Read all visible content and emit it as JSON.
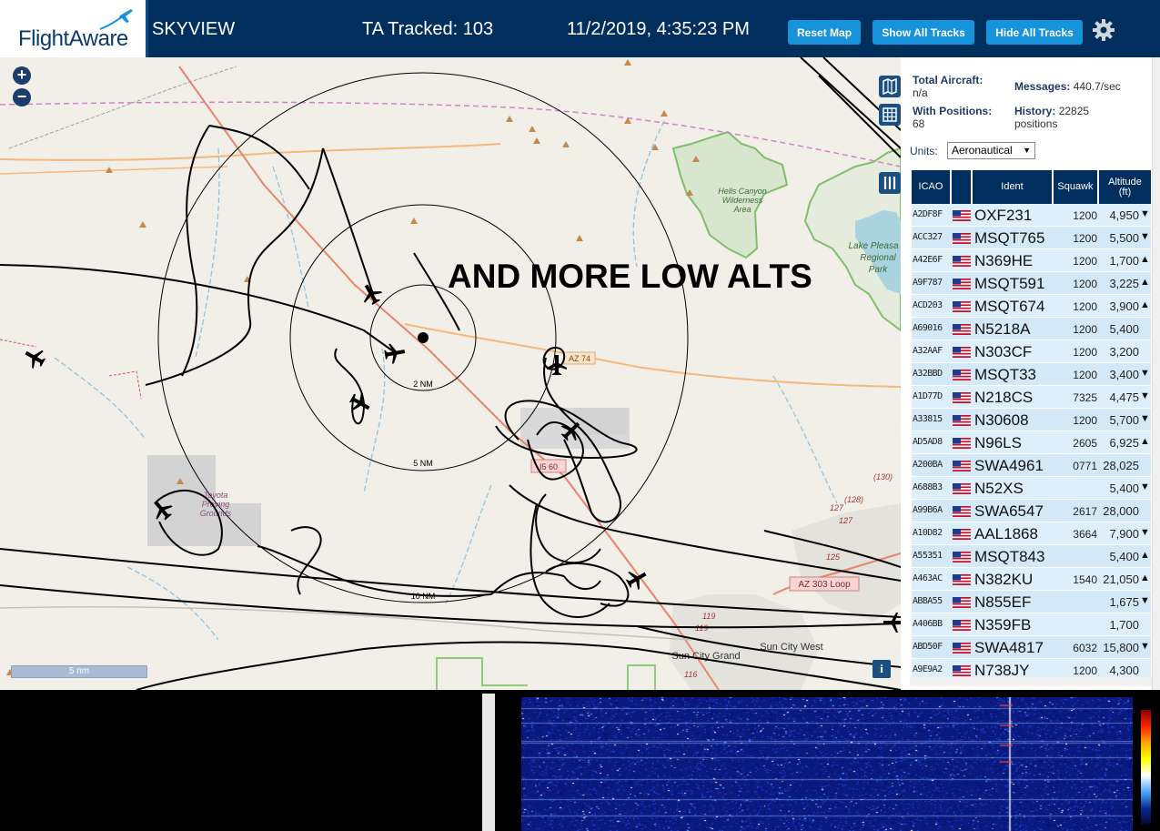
{
  "header": {
    "logo_text": "FlightAware",
    "title": "SKYVIEW",
    "tracked": "TA Tracked: 103",
    "datetime": "11/2/2019, 4:35:23 PM",
    "buttons": {
      "reset": "Reset Map",
      "show_all": "Show All Tracks",
      "hide_all": "Hide All Tracks"
    },
    "settings_icon": "gear-icon",
    "brand_color": "#002f5d",
    "button_color": "#1793db"
  },
  "map": {
    "zoom_in": "+",
    "zoom_out": "−",
    "overlay_text": "AND MORE LOW ALTS",
    "scale_label": "5 nm",
    "info_label": "i",
    "range_labels": [
      "2 NM",
      "5 NM",
      "10 NM"
    ],
    "place_labels": {
      "hells_canyon": [
        "Hells Canyon",
        "Wilderness",
        "Area"
      ],
      "lake_pleasant": [
        "Lake Pleasa",
        "Regional",
        "Park"
      ],
      "toyota": [
        "Toyota",
        "Proving",
        "Grounds"
      ],
      "sun_city_grand": "Sun City Grand",
      "sun_city_west": "Sun City West"
    },
    "road_labels": [
      "AZ 74",
      "I5 60",
      "AZ 303 Loop",
      "(130)",
      "(128)",
      "127",
      "125",
      "119",
      "119",
      "116",
      "127"
    ]
  },
  "panel": {
    "total_aircraft_label": "Total Aircraft:",
    "total_aircraft_value": "n/a",
    "with_positions_label": "With Positions:",
    "with_positions_value": "68",
    "messages_label": "Messages:",
    "messages_value": "440.7/sec",
    "history_label": "History:",
    "history_value": "22825",
    "history_unit": "positions",
    "units_label": "Units:",
    "units_value": "Aeronautical",
    "columns": {
      "icao": "ICAO",
      "ident": "Ident",
      "squawk": "Squawk",
      "altitude_top": "Altitude",
      "altitude_unit": "(ft)"
    },
    "rows": [
      {
        "icao": "A2DF8F",
        "ident": "OXF231",
        "squawk": "1200",
        "alt": "4,950",
        "trend": "▼"
      },
      {
        "icao": "ACC327",
        "ident": "MSQT765",
        "squawk": "1200",
        "alt": "5,500",
        "trend": "▼"
      },
      {
        "icao": "A42E6F",
        "ident": "N369HE",
        "squawk": "1200",
        "alt": "1,700",
        "trend": "▲"
      },
      {
        "icao": "A9F787",
        "ident": "MSQT591",
        "squawk": "1200",
        "alt": "3,225",
        "trend": "▲"
      },
      {
        "icao": "ACD203",
        "ident": "MSQT674",
        "squawk": "1200",
        "alt": "3,900",
        "trend": "▲"
      },
      {
        "icao": "A69016",
        "ident": "N5218A",
        "squawk": "1200",
        "alt": "5,400",
        "trend": ""
      },
      {
        "icao": "A32AAF",
        "ident": "N303CF",
        "squawk": "1200",
        "alt": "3,200",
        "trend": ""
      },
      {
        "icao": "A32BBD",
        "ident": "MSQT33",
        "squawk": "1200",
        "alt": "3,400",
        "trend": "▼"
      },
      {
        "icao": "A1D77D",
        "ident": "N218CS",
        "squawk": "7325",
        "alt": "4,475",
        "trend": "▼"
      },
      {
        "icao": "A33815",
        "ident": "N30608",
        "squawk": "1200",
        "alt": "5,700",
        "trend": "▼"
      },
      {
        "icao": "AD5AD8",
        "ident": "N96LS",
        "squawk": "2605",
        "alt": "6,925",
        "trend": "▲"
      },
      {
        "icao": "A200BA",
        "ident": "SWA4961",
        "squawk": "0771",
        "alt": "28,025",
        "trend": ""
      },
      {
        "icao": "A688B3",
        "ident": "N52XS",
        "squawk": "",
        "alt": "5,400",
        "trend": "▼"
      },
      {
        "icao": "A99B6A",
        "ident": "SWA6547",
        "squawk": "2617",
        "alt": "28,000",
        "trend": ""
      },
      {
        "icao": "A10D82",
        "ident": "AAL1868",
        "squawk": "3664",
        "alt": "7,900",
        "trend": "▼"
      },
      {
        "icao": "A55351",
        "ident": "MSQT843",
        "squawk": "",
        "alt": "5,400",
        "trend": "▲"
      },
      {
        "icao": "A463AC",
        "ident": "N382KU",
        "squawk": "1540",
        "alt": "21,050",
        "trend": "▲"
      },
      {
        "icao": "ABBA55",
        "ident": "N855EF",
        "squawk": "",
        "alt": "1,675",
        "trend": "▼"
      },
      {
        "icao": "A406BB",
        "ident": "N359FB",
        "squawk": "",
        "alt": "1,700",
        "trend": ""
      },
      {
        "icao": "ABD50F",
        "ident": "SWA4817",
        "squawk": "6032",
        "alt": "15,800",
        "trend": "▼"
      },
      {
        "icao": "A9E9A2",
        "ident": "N738JY",
        "squawk": "1200",
        "alt": "4,300",
        "trend": ""
      }
    ]
  }
}
